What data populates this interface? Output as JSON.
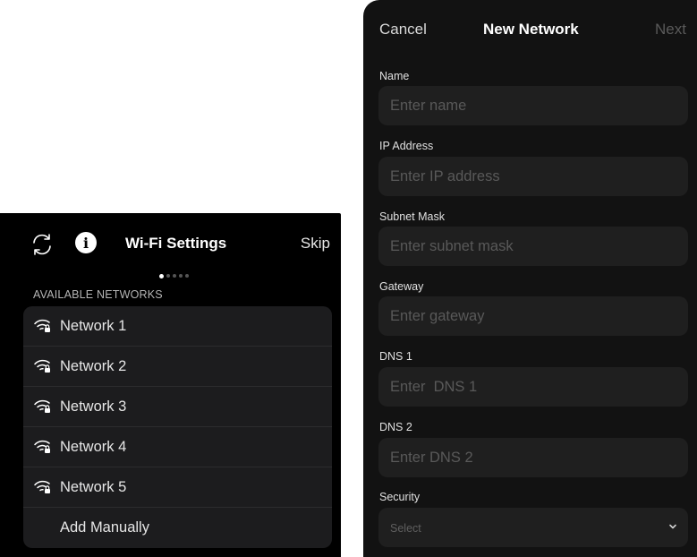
{
  "wifi_screen": {
    "title": "Wi-Fi Settings",
    "skip_label": "Skip",
    "info_glyph": "i",
    "icons": [
      "refresh-icon",
      "info-icon",
      "wifi-lock-icon"
    ],
    "pager": {
      "total": 5,
      "active": 1
    },
    "section_label": "AVAILABLE NETWORKS",
    "networks": [
      {
        "label": "Network 1"
      },
      {
        "label": "Network 2"
      },
      {
        "label": "Network 3"
      },
      {
        "label": "Network 4"
      },
      {
        "label": "Network 5"
      }
    ],
    "add_manually_label": "Add Manually"
  },
  "new_network": {
    "cancel_label": "Cancel",
    "title": "New Network",
    "next_label": "Next",
    "fields": [
      {
        "label": "Name",
        "placeholder": "Enter name",
        "value": ""
      },
      {
        "label": "IP Address",
        "placeholder": "Enter IP address",
        "value": ""
      },
      {
        "label": "Subnet Mask",
        "placeholder": "Enter subnet mask",
        "value": ""
      },
      {
        "label": "Gateway",
        "placeholder": "Enter gateway",
        "value": ""
      },
      {
        "label": "DNS 1",
        "placeholder": "Enter  DNS 1",
        "value": ""
      },
      {
        "label": "DNS 2",
        "placeholder": "Enter DNS 2",
        "value": ""
      }
    ],
    "security": {
      "label": "Security",
      "selected": "Select"
    }
  },
  "colors": {
    "left_background": "#000000",
    "right_background": "#121212",
    "card": "#1c1c1e",
    "field": "#1f1f1f",
    "placeholder": "#595959",
    "disabled_next": "#5a5a5a"
  }
}
